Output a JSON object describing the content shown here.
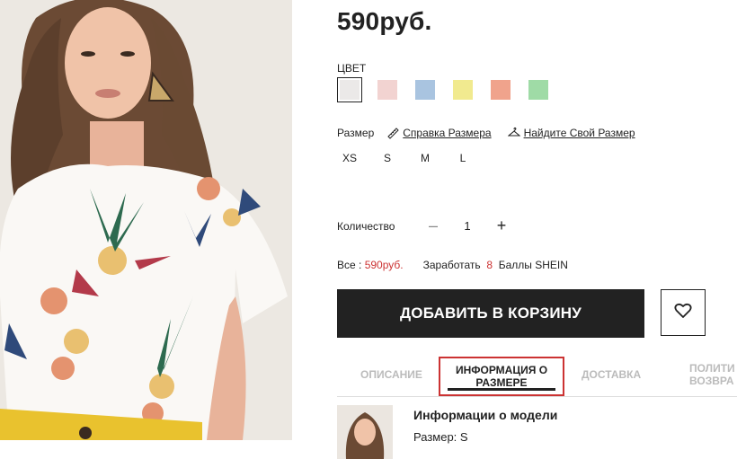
{
  "product": {
    "price": "590руб."
  },
  "color": {
    "label": "ЦВЕТ",
    "swatches": [
      "#ebe9e8",
      "#f2d3d1",
      "#a9c4e0",
      "#f1ea8f",
      "#f0a38c",
      "#9fdba6"
    ],
    "selected_index": 0
  },
  "size": {
    "label": "Размер",
    "guide_link": "Справка Размера",
    "find_link": "Найдите Свой Размер",
    "options": [
      "XS",
      "S",
      "M",
      "L"
    ]
  },
  "quantity": {
    "label": "Количество",
    "value": "1",
    "minus": "–",
    "plus": "+"
  },
  "total": {
    "prefix": "Все :",
    "amount": "590руб.",
    "earn_label": "Заработать",
    "points": "8",
    "points_label": "Баллы SHEIN"
  },
  "actions": {
    "add_to_cart": "ДОБАВИТЬ В КОРЗИНУ",
    "wishlist_icon": "heart-icon"
  },
  "tabs": {
    "description": "ОПИСАНИЕ",
    "size_info_line1": "ИНФОРМАЦИЯ О",
    "size_info_line2": "РАЗМЕРЕ",
    "delivery": "ДОСТАВКА",
    "policy_line1": "ПОЛИТИ",
    "policy_line2": "ВОЗВРА"
  },
  "model": {
    "title": "Информации о модели",
    "size": "Размер: S"
  },
  "colors": {
    "price": "#222222",
    "accent_red": "#cc3333",
    "button_bg": "#222222"
  }
}
